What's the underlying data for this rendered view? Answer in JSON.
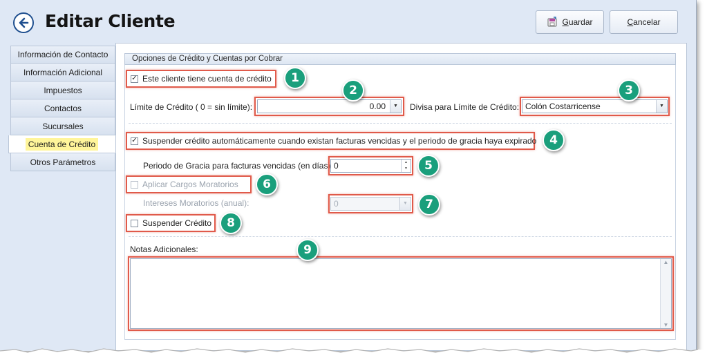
{
  "header": {
    "title": "Editar Cliente",
    "save_label": "Guardar",
    "cancel_label": "Cancelar"
  },
  "sidebar": {
    "items": [
      {
        "label": "Información de Contacto"
      },
      {
        "label": "Información Adicional"
      },
      {
        "label": "Impuestos"
      },
      {
        "label": "Contactos"
      },
      {
        "label": "Sucursales"
      },
      {
        "label": "Cuenta de Crédito"
      },
      {
        "label": "Otros Parámetros"
      }
    ],
    "active_index": 5
  },
  "credit": {
    "group_title": "Opciones de Crédito y Cuentas por Cobrar",
    "has_credit_label": "Este cliente tiene cuenta de crédito",
    "has_credit_checked": true,
    "limit_label": "Límite de Crédito ( 0 = sin límite):",
    "limit_value": "0.00",
    "currency_label": "Divisa para Límite de Crédito:",
    "currency_value": "Colón Costarricense",
    "suspend_auto_label": "Suspender crédito automáticamente cuando existan facturas vencidas y el periodo de gracia haya expirado",
    "suspend_auto_checked": true,
    "grace_label": "Periodo de Gracia para facturas vencidas (en días):",
    "grace_value": "0",
    "late_charges_label": "Aplicar Cargos Moratorios",
    "late_charges_checked": false,
    "interest_label": "Intereses Moratorios (anual):",
    "interest_value": "0",
    "suspend_credit_label": "Suspender Crédito",
    "suspend_credit_checked": false,
    "notes_label": "Notas Adicionales:",
    "notes_value": ""
  },
  "callouts": [
    "1",
    "2",
    "3",
    "4",
    "5",
    "6",
    "7",
    "8",
    "9"
  ],
  "colors": {
    "accent_red": "#e05a4a",
    "badge_green": "#1a9f7c",
    "active_highlight": "#fff59a",
    "back_arrow": "#1f4f8f"
  },
  "icons": {
    "back": "back-arrow-icon",
    "save": "save-icon",
    "check": "check-icon",
    "dropdown": "chevron-down-icon"
  }
}
